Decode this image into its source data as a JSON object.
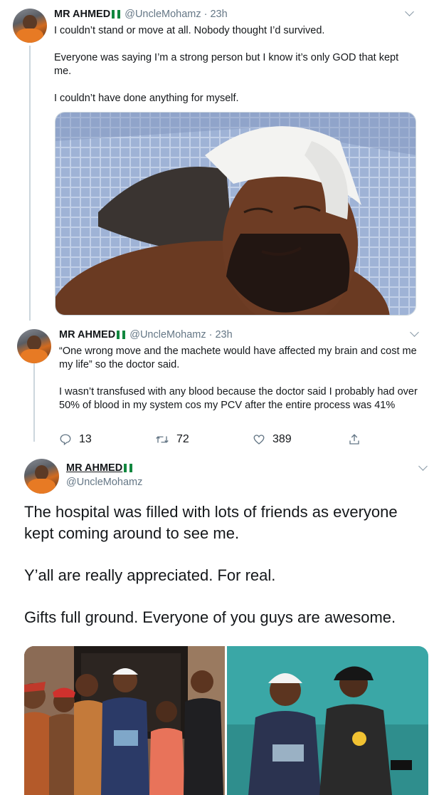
{
  "tweet1": {
    "author_name": "MR AHMED",
    "handle": "@UncleMohamz",
    "separator": "·",
    "time": "23h",
    "paragraphs": [
      "I couldn’t stand or move at all. Nobody thought I’d survived.",
      "Everyone was saying I’m a strong person but I know it’s only GOD that kept me.",
      "I couldn’t have done anything for myself."
    ]
  },
  "tweet2": {
    "author_name": "MR AHMED",
    "handle": "@UncleMohamz",
    "separator": "·",
    "time": "23h",
    "paragraphs": [
      "“One wrong move and the machete would have affected my brain and cost me my life” so the doctor said.",
      "I wasn’t transfused with any blood because the doctor said I probably had over 50% of blood in my system cos my PCV after the entire process was 41%"
    ],
    "actions": {
      "replies": "13",
      "retweets": "72",
      "likes": "389"
    }
  },
  "tweet3": {
    "author_name": "MR AHMED",
    "handle": "@UncleMohamz",
    "paragraphs": [
      "The hospital was filled with lots of friends as everyone kept coming around to see me.",
      "Y’all are really appreciated. For real.",
      "Gifts full ground. Everyone of you guys are awesome."
    ]
  },
  "icons": [
    "chevron-down-icon",
    "reply-icon",
    "retweet-icon",
    "like-icon",
    "share-icon",
    "nigeria-flag-icon"
  ],
  "colors": {
    "text": "#14171a",
    "secondary": "#657786",
    "border": "#ccd6dd",
    "flag_green": "#11873f"
  }
}
